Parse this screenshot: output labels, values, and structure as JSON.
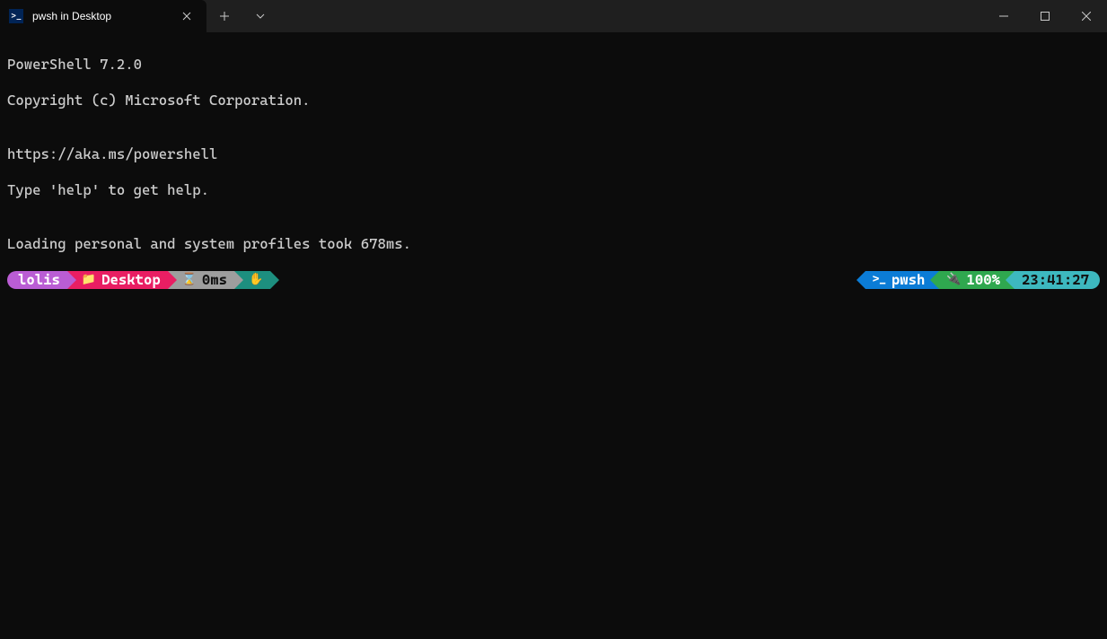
{
  "window": {
    "tab_title": "pwsh in Desktop"
  },
  "terminal": {
    "lines": [
      "PowerShell 7.2.0",
      "Copyright (c) Microsoft Corporation.",
      "",
      "https://aka.ms/powershell",
      "Type 'help' to get help.",
      "",
      "Loading personal and system profiles took 678ms."
    ]
  },
  "prompt": {
    "left": {
      "user": "lolis",
      "folder": "Desktop",
      "exec_time": "0ms"
    },
    "right": {
      "shell": "pwsh",
      "battery": "100%",
      "clock": "23:41:27"
    }
  }
}
